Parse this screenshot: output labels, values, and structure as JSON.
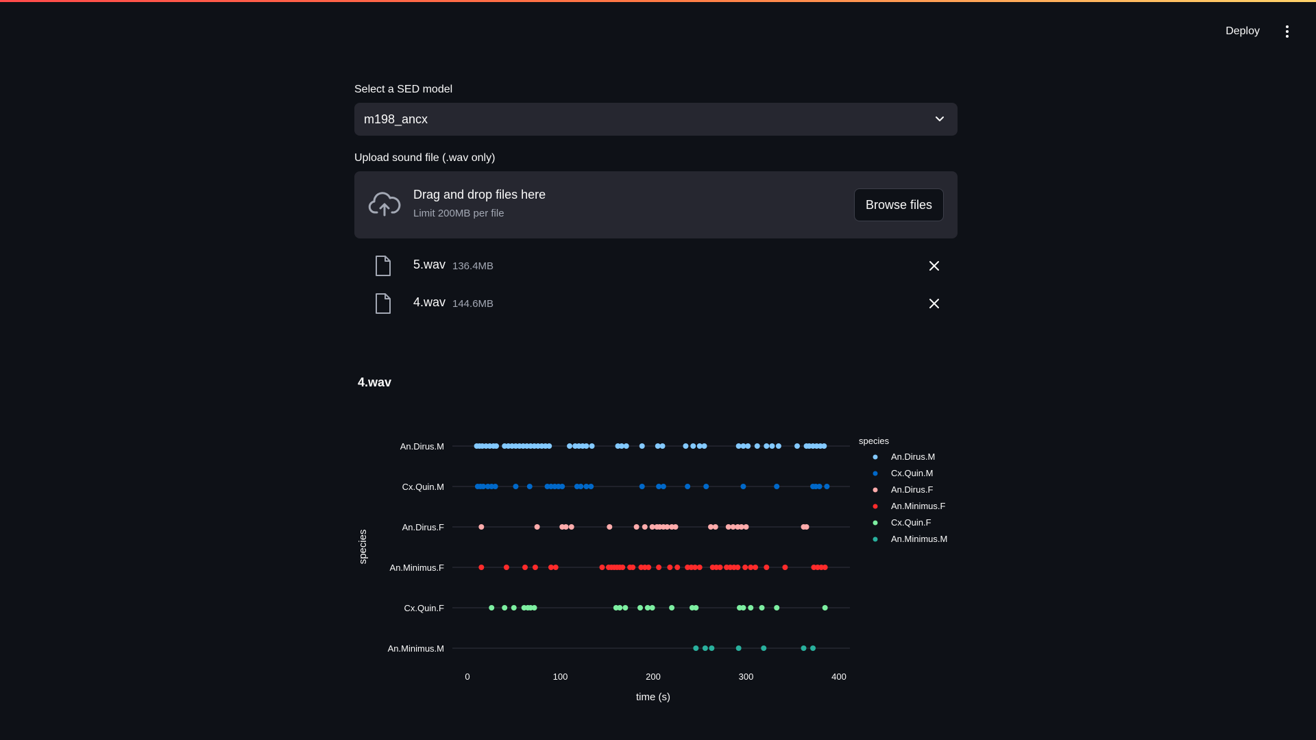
{
  "header": {
    "deploy_label": "Deploy",
    "menu_icon": "kebab-menu-icon"
  },
  "model_select": {
    "label": "Select a SED model",
    "value": "m198_ancx"
  },
  "uploader": {
    "label": "Upload sound file (.wav only)",
    "title": "Drag and drop files here",
    "limit": "Limit 200MB per file",
    "browse_label": "Browse files",
    "icon": "cloud-upload-icon"
  },
  "files": [
    {
      "name": "5.wav",
      "size": "136.4MB"
    },
    {
      "name": "4.wav",
      "size": "144.6MB"
    }
  ],
  "result": {
    "title": "4.wav"
  },
  "chart_data": {
    "type": "scatter",
    "title": "",
    "xlabel": "time (s)",
    "ylabel": "species",
    "xlim": [
      0,
      400
    ],
    "xticks": [
      0,
      100,
      200,
      300,
      400
    ],
    "grid": true,
    "legend_title": "species",
    "legend_position": "right",
    "categories": [
      "An.Dirus.M",
      "Cx.Quin.M",
      "An.Dirus.F",
      "An.Minimus.F",
      "Cx.Quin.F",
      "An.Minimus.M"
    ],
    "series": [
      {
        "name": "An.Dirus.M",
        "color": "#83c9ff",
        "x": [
          10,
          13,
          16,
          20,
          24,
          28,
          31,
          40,
          44,
          48,
          52,
          56,
          60,
          64,
          68,
          72,
          76,
          80,
          84,
          88,
          110,
          116,
          120,
          124,
          128,
          134,
          162,
          166,
          171,
          188,
          205,
          210,
          235,
          243,
          250,
          255,
          292,
          297,
          302,
          312,
          322,
          328,
          335,
          355,
          365,
          368,
          372,
          376,
          380,
          384
        ]
      },
      {
        "name": "Cx.Quin.M",
        "color": "#0068c9",
        "x": [
          11,
          14,
          17,
          22,
          26,
          30,
          52,
          67,
          86,
          90,
          94,
          98,
          102,
          118,
          122,
          128,
          133,
          188,
          206,
          211,
          237,
          257,
          297,
          333,
          372,
          375,
          379,
          387
        ]
      },
      {
        "name": "An.Dirus.F",
        "color": "#ffabab",
        "x": [
          15,
          75,
          102,
          106,
          112,
          153,
          182,
          191,
          199,
          204,
          207,
          211,
          215,
          220,
          224,
          262,
          267,
          281,
          286,
          291,
          295,
          300,
          362,
          365
        ]
      },
      {
        "name": "An.Minimus.F",
        "color": "#ff2b2b",
        "x": [
          15,
          42,
          62,
          73,
          90,
          95,
          145,
          152,
          155,
          158,
          161,
          164,
          167,
          175,
          178,
          187,
          191,
          195,
          206,
          218,
          226,
          237,
          241,
          245,
          250,
          264,
          268,
          272,
          279,
          283,
          287,
          291,
          299,
          305,
          310,
          322,
          342,
          373,
          377,
          381,
          385
        ]
      },
      {
        "name": "Cx.Quin.F",
        "color": "#7defa1",
        "x": [
          26,
          40,
          50,
          61,
          65,
          68,
          72,
          160,
          164,
          170,
          186,
          194,
          199,
          220,
          242,
          246,
          293,
          297,
          305,
          317,
          333,
          385
        ]
      },
      {
        "name": "An.Minimus.M",
        "color": "#29b09d",
        "x": [
          246,
          256,
          263,
          292,
          319,
          362,
          372
        ]
      }
    ]
  }
}
